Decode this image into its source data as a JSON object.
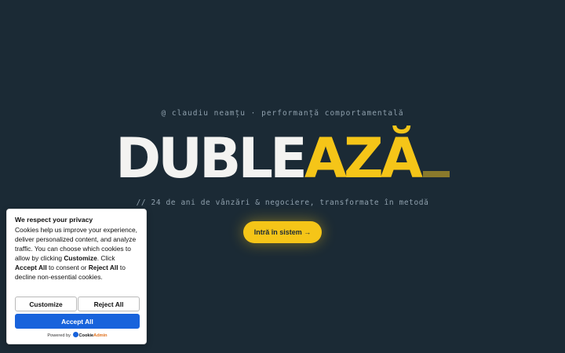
{
  "hero": {
    "eyebrow": "@ claudiu neamțu · performanță comportamentală",
    "title_white": "DUBLE",
    "title_yellow": "AZĂ",
    "tagline": "// 24 de ani de vânzări & negociere, transformate în metodă",
    "cta_label": "Intră în sistem →"
  },
  "consent": {
    "heading": "We respect your privacy",
    "body_1": "Cookies help us improve your experience, deliver personalized content, and analyze traffic. You can choose which cookies to allow by clicking ",
    "body_bold_1": "Customize",
    "body_2": ". Click ",
    "body_bold_2": "Accept All",
    "body_3": " to consent or ",
    "body_bold_3": "Reject All",
    "body_4": " to decline non-essential cookies.",
    "customize_label": "Customize",
    "reject_label": "Reject All",
    "accept_label": "Accept All",
    "powered_by": "Powered by",
    "brand_name_a": "Cookie",
    "brand_name_b": "Admin"
  },
  "colors": {
    "background": "#1b2a35",
    "accent": "#f5c518",
    "accept_button": "#1863dc"
  }
}
